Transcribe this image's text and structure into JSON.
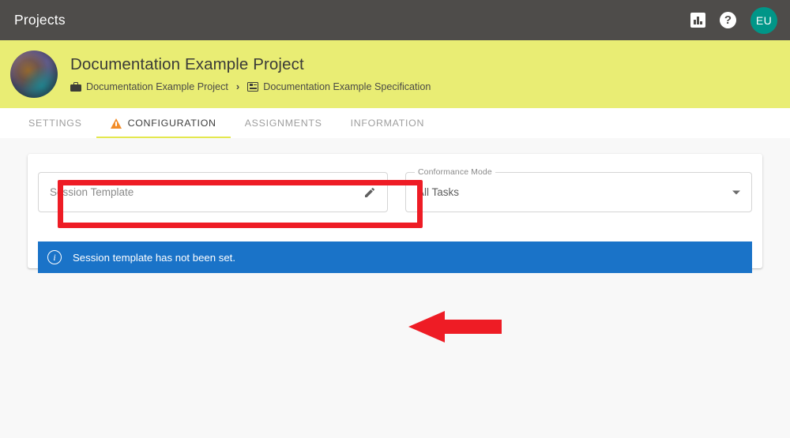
{
  "appbar": {
    "title": "Projects",
    "insights_icon": "bar-chart-icon",
    "help_icon": "help-icon",
    "help_glyph": "?",
    "avatar_initials": "EU",
    "avatar_color": "#009688",
    "background": "#4e4c4a"
  },
  "banner": {
    "background": "#e9ed74",
    "project_title": "Documentation Example Project",
    "avatar_icon": "globe-avatar",
    "breadcrumb": [
      {
        "icon": "briefcase-icon",
        "label": "Documentation Example Project"
      },
      {
        "icon": "specification-icon",
        "label": "Documentation Example Specification"
      }
    ],
    "breadcrumb_separator": "›"
  },
  "tabs": [
    {
      "label": "SETTINGS",
      "active": false,
      "icon": null
    },
    {
      "label": "CONFIGURATION",
      "active": true,
      "icon": "warning-triangle-icon"
    },
    {
      "label": "ASSIGNMENTS",
      "active": false,
      "icon": null
    },
    {
      "label": "INFORMATION",
      "active": false,
      "icon": null
    }
  ],
  "tab_indicator_color": "#e4e84f",
  "form": {
    "session_template": {
      "placeholder": "Session Template",
      "value": "",
      "edit_icon": "pencil-icon"
    },
    "conformance_mode": {
      "legend": "Conformance Mode",
      "value": "All Tasks",
      "dropdown_icon": "chevron-down-icon"
    }
  },
  "info_banner": {
    "icon": "info-circle-icon",
    "glyph": "i",
    "message": "Session template has not been set.",
    "background": "#1a73c8"
  },
  "annotations": {
    "highlight_rect_color": "#ee1c25",
    "arrow_color": "#ee1c25",
    "arrow_direction": "left"
  }
}
